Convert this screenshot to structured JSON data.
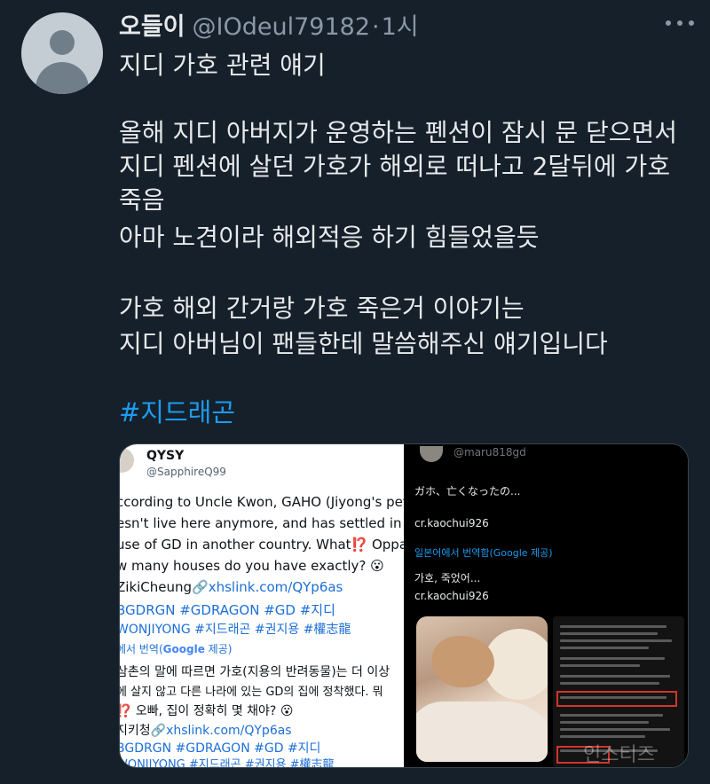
{
  "tweet": {
    "display_name": "오들이",
    "handle": "@IOdeul79182",
    "separator": "·",
    "time": "1시",
    "lines": [
      "지디 가호 관련 얘기",
      "올해 지디 아버지가 운영하는 펜션이 잠시 문 닫으면서",
      "지디 펜션에 살던 가호가 해외로 떠나고 2달뒤에 가호",
      "죽음",
      "아마 노견이라 해외적응 하기 힘들었을듯",
      "가호 해외 간거랑 가호 죽은거 이야기는",
      "지디 아버님이 팬들한테 말씀해주신 얘기입니다"
    ],
    "hashtag": "#지드래곤"
  },
  "media": {
    "left": {
      "name": "QYSY",
      "handle": "@SapphireQ99",
      "lines": [
        "ccording to Uncle Kwon, GAHO (Jiyong's pet)",
        "esn't live here anymore, and has settled in a",
        "use of GD in another country. What⁉️ Oppa",
        "w many houses do you have exactly? 😮",
        "ZikiCheung",
        "xhslink.com/QYp6as",
        "BGDRGN #GDRAGON #GD #지디",
        "WONJIYONG #지드래곤 #권지용 #權志龍"
      ],
      "translate_prefix": "에서 번역(",
      "translate_google": "Google",
      "translate_suffix": " 제공)",
      "kr_lines": [
        "삼촌의 말에 따르면 가호(지용의 반려동물)는 더 이상",
        "에 살지 않고 다른 나라에 있는 GD의 집에 정착했다. 뭐",
        "⁉️ 오빠, 집이 정확히 몇 채야? 😮",
        "지키청",
        "xhslink.com/QYp6as",
        "BGDRGN #GDRAGON #GD #지디",
        "WONJIYONG #지드래곤 #권지용 #權志龍"
      ]
    },
    "right": {
      "handle": "@maru818gd",
      "jp_text": "ガホ、亡くなったの...",
      "credit": "cr.kaochui926",
      "translate": "일본어에서 번역함(Google 제공)",
      "kr_text": "가호, 죽었어...",
      "credit2": "cr.kaochui926"
    },
    "watermark": "인스티즈"
  }
}
